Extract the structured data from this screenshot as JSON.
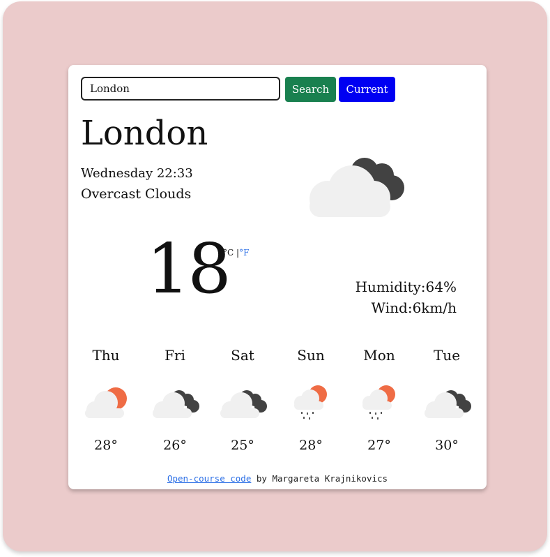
{
  "colors": {
    "frame_bg": "#ebcbcb",
    "card_bg": "#ffffff",
    "search_button": "#19804f",
    "current_button": "#0000f2",
    "link": "#2a6ee6",
    "sun": "#ef6c45",
    "dark_cloud": "#424242",
    "light_cloud": "#f0f0f0"
  },
  "search": {
    "value": "London",
    "search_label": "Search",
    "current_label": "Current"
  },
  "current": {
    "city": "London",
    "datetime": "Wednesday 22:33",
    "description": "Overcast Clouds",
    "icon": "broken-clouds-icon",
    "temperature": "18",
    "unit_celsius": "°C",
    "unit_separator": "|",
    "unit_fahrenheit": "°F",
    "humidity": "Humidity:64%",
    "wind": "Wind:6km/h"
  },
  "forecast": [
    {
      "day": "Thu",
      "temp": "28°",
      "icon": "partly-sunny-icon"
    },
    {
      "day": "Fri",
      "temp": "26°",
      "icon": "broken-clouds-icon"
    },
    {
      "day": "Sat",
      "temp": "25°",
      "icon": "broken-clouds-icon"
    },
    {
      "day": "Sun",
      "temp": "28°",
      "icon": "rain-sun-icon"
    },
    {
      "day": "Mon",
      "temp": "27°",
      "icon": "rain-sun-icon"
    },
    {
      "day": "Tue",
      "temp": "30°",
      "icon": "broken-clouds-icon"
    }
  ],
  "footer": {
    "link_text": "Open-course code",
    "suffix": " by Margareta Krajnikovics"
  }
}
